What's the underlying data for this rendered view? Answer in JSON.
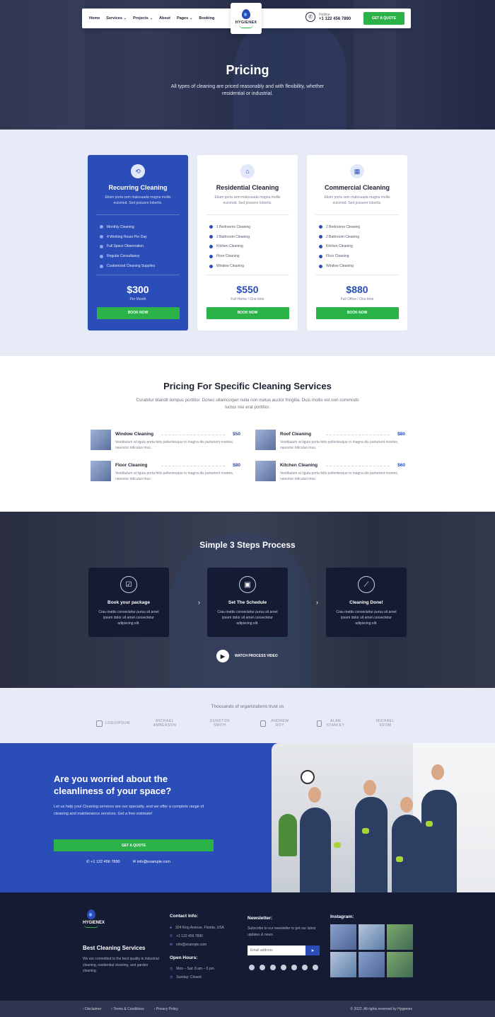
{
  "nav": {
    "items": [
      {
        "label": "Home",
        "dropdown": false
      },
      {
        "label": "Services",
        "dropdown": true
      },
      {
        "label": "Projects",
        "dropdown": true
      },
      {
        "label": "About",
        "dropdown": false
      },
      {
        "label": "Pages",
        "dropdown": true
      },
      {
        "label": "Booking",
        "dropdown": false
      }
    ],
    "logo_text": "HYGIENEX",
    "hotline_label": "Hotline",
    "hotline_number": "+1 122 456 7890",
    "quote_button": "GET A QUOTE"
  },
  "hero": {
    "title": "Pricing",
    "subtitle": "All types of cleaning are priced reasonably and with flexibility, whether residential or industrial."
  },
  "pricing": {
    "plans": [
      {
        "icon": "recurring-icon",
        "title": "Recurring Cleaning",
        "desc": "Etiam porta sem malesuada magna mollis euismod. Sed posuere lobortis.",
        "features": [
          "Monthly Cleaning",
          "4 Working Hours Per Day",
          "Full Space Observation",
          "Regular Consultancy",
          "Customized Cleaning Supplies"
        ],
        "price": "$300",
        "period": "Per Month",
        "button": "BOOK NOW",
        "featured": true
      },
      {
        "icon": "home-icon",
        "title": "Residential Cleaning",
        "desc": "Etiam porta sem malesuada magna mollis euismod. Sed posuere lobortis.",
        "features": [
          "1 Bedrooms Cleaning",
          "2 Bathroom Cleaning",
          "Kitchen Cleaning",
          "Floor Cleaning",
          "Window Cleaning"
        ],
        "price": "$550",
        "period": "Full Home / One time",
        "button": "BOOK NOW",
        "featured": false
      },
      {
        "icon": "office-icon",
        "title": "Commercial Cleaning",
        "desc": "Etiam porta sem malesuada magna mollis euismod. Sed posuere lobortis.",
        "features": [
          "2 Bedrooms Cleaning",
          "2 Bathroom Cleaning",
          "Kitchen Cleaning",
          "Floor Cleaning",
          "Window Cleaning"
        ],
        "price": "$880",
        "period": "Full Office / One time",
        "button": "BOOK NOW",
        "featured": false
      }
    ]
  },
  "specific": {
    "title": "Pricing For Specific Cleaning Services",
    "subtitle": "Curabitur blandit tempus porttitor. Donec ullamcorper nulla non metus auctor fringilla. Duis mollis est non commodo luctus nisi erat porttitor.",
    "services": [
      {
        "name": "Window Cleaning",
        "price": "$50",
        "desc": "Vestibulum at ligula porta felis pellentesque in magna dis parturient montes, nascetur ridiculus mus."
      },
      {
        "name": "Roof Cleaning",
        "price": "$80",
        "desc": "Vestibulum at ligula porta felis pellentesque in magna dis parturient montes, nascetur ridiculus mus."
      },
      {
        "name": "Floor Cleaning",
        "price": "$80",
        "desc": "Vestibulum at ligula porta felis pellentesque in magna dis parturient montes, nascetur ridiculus mus."
      },
      {
        "name": "Kitchen Cleaning",
        "price": "$60",
        "desc": "Vestibulum at ligula porta felis pellentesque in magna dis parturient montes, nascetur ridiculus mus."
      }
    ]
  },
  "steps": {
    "title": "Simple 3 Steps Process",
    "items": [
      {
        "icon": "clipboard-icon",
        "title": "Book your package",
        "desc": "Cras mattis consectetur purus sit amet ipsum dolor sit amet consectetur adipiscing elit."
      },
      {
        "icon": "calendar-icon",
        "title": "Set The Schedule",
        "desc": "Cras mattis consectetur purus sit amet ipsum dolor sit amet consectetur adipiscing elit."
      },
      {
        "icon": "broom-icon",
        "title": "Cleaning Done!",
        "desc": "Cras mattis consectetur purus sit amet ipsum dolor sit amet consectetur adipiscing elit."
      }
    ],
    "watch_label": "WATCH PROCESS VIDEO"
  },
  "trust": {
    "title": "Thousands of organizations trust us",
    "brands": [
      "LOGOIPSUM",
      "MICHAEL AMBERSON",
      "DUNSTON SMITH",
      "ANDREW ROY",
      "ALAN STANLEY",
      "MICHAEL FROM"
    ]
  },
  "cta": {
    "title": "Are you worried about the cleanliness of your space?",
    "text": "Let us help you! Cleaning services are our specialty, and we offer a complete range of cleaning and maintenance services. Get a free estimate!",
    "button": "GET A QUOTE",
    "phone": "+1 122 456 7890",
    "email": "info@example.com"
  },
  "footer": {
    "logo_text": "HYGIENEX",
    "tagline": "Best Cleaning Services",
    "about": "We are committed to the best quality in industrial cleaning, residential cleaning, and garden cleaning.",
    "contact_title": "Contact Info:",
    "address": "324 King Avenue, Florida, USA",
    "phone": "+1 122 456 7890",
    "email": "info@example.com",
    "hours_title": "Open Hours:",
    "hours_weekday": "Mon – Sat: 8 am – 5 pm",
    "hours_sunday": "Sunday: Closed",
    "newsletter_title": "Newsletter:",
    "newsletter_text": "Subscribe to our newsletter to get our latest updates & news.",
    "email_placeholder": "Email address",
    "instagram_title": "Instagram:"
  },
  "bottom": {
    "links": [
      "Disclaimer",
      "Terms & Conditions",
      "Privacy Policy"
    ],
    "copyright": "© 2022. All rights reserved by Hygienex"
  },
  "colors": {
    "primary": "#2a4db7",
    "accent": "#2bb34a",
    "dark": "#141b33",
    "light_bg": "#e7ebf8"
  }
}
